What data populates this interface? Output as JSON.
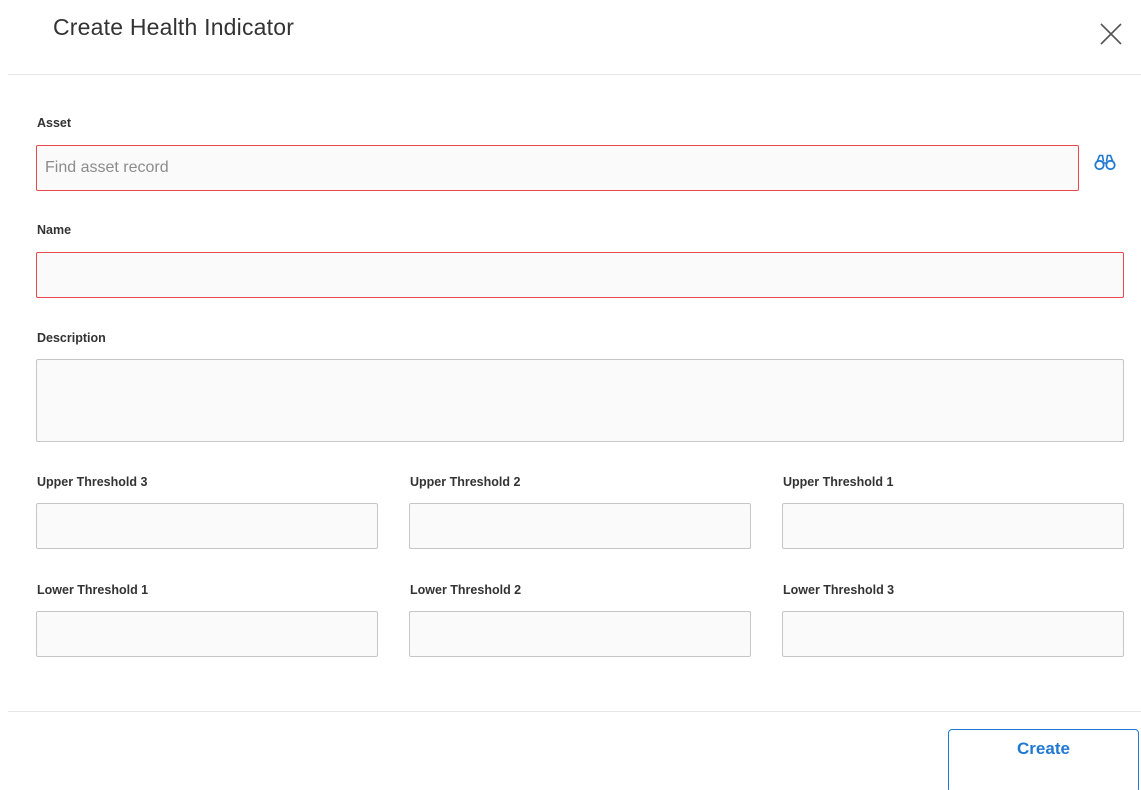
{
  "dialog": {
    "title": "Create Health Indicator"
  },
  "fields": {
    "asset": {
      "label": "Asset",
      "placeholder": "Find asset record",
      "value": ""
    },
    "name": {
      "label": "Name",
      "value": ""
    },
    "description": {
      "label": "Description",
      "value": ""
    },
    "upper_threshold_3": {
      "label": "Upper Threshold 3",
      "value": ""
    },
    "upper_threshold_2": {
      "label": "Upper Threshold 2",
      "value": ""
    },
    "upper_threshold_1": {
      "label": "Upper Threshold 1",
      "value": ""
    },
    "lower_threshold_1": {
      "label": "Lower Threshold 1",
      "value": ""
    },
    "lower_threshold_2": {
      "label": "Lower Threshold 2",
      "value": ""
    },
    "lower_threshold_3": {
      "label": "Lower Threshold 3",
      "value": ""
    }
  },
  "icons": {
    "close": "close-icon",
    "asset_search": "binoculars-icon"
  },
  "footer": {
    "create_label": "Create"
  },
  "colors": {
    "accent": "#1f78d1",
    "invalid_border": "#e8484a",
    "field_border": "#c6c6c6",
    "field_background": "#fafafa",
    "text": "#333333"
  }
}
